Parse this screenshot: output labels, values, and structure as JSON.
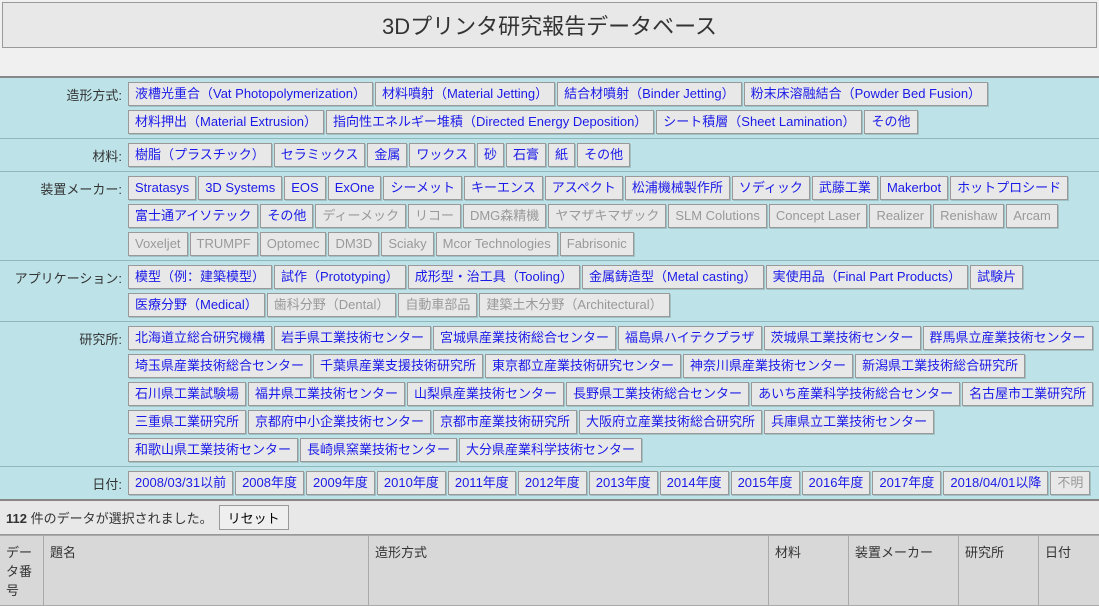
{
  "title": "3Dプリンタ研究報告データベース",
  "filters": [
    {
      "label": "造形方式:",
      "items": [
        {
          "text": "液槽光重合（Vat Photopolymerization）",
          "enabled": true
        },
        {
          "text": "材料噴射（Material Jetting）",
          "enabled": true
        },
        {
          "text": "結合材噴射（Binder Jetting）",
          "enabled": true
        },
        {
          "text": "粉末床溶融結合（Powder Bed Fusion）",
          "enabled": true
        },
        {
          "text": "材料押出（Material Extrusion）",
          "enabled": true
        },
        {
          "text": "指向性エネルギー堆積（Directed Energy Deposition）",
          "enabled": true
        },
        {
          "text": "シート積層（Sheet Lamination）",
          "enabled": true
        },
        {
          "text": "その他",
          "enabled": true
        }
      ]
    },
    {
      "label": "材料:",
      "items": [
        {
          "text": "樹脂（プラスチック）",
          "enabled": true
        },
        {
          "text": "セラミックス",
          "enabled": true
        },
        {
          "text": "金属",
          "enabled": true
        },
        {
          "text": "ワックス",
          "enabled": true
        },
        {
          "text": "砂",
          "enabled": true
        },
        {
          "text": "石膏",
          "enabled": true
        },
        {
          "text": "紙",
          "enabled": true
        },
        {
          "text": "その他",
          "enabled": true
        }
      ]
    },
    {
      "label": "装置メーカー:",
      "items": [
        {
          "text": "Stratasys",
          "enabled": true
        },
        {
          "text": "3D Systems",
          "enabled": true
        },
        {
          "text": "EOS",
          "enabled": true
        },
        {
          "text": "ExOne",
          "enabled": true
        },
        {
          "text": "シーメット",
          "enabled": true
        },
        {
          "text": "キーエンス",
          "enabled": true
        },
        {
          "text": "アスペクト",
          "enabled": true
        },
        {
          "text": "松浦機械製作所",
          "enabled": true
        },
        {
          "text": "ソディック",
          "enabled": true
        },
        {
          "text": "武藤工業",
          "enabled": true
        },
        {
          "text": "Makerbot",
          "enabled": true
        },
        {
          "text": "ホットプロシード",
          "enabled": true
        },
        {
          "text": "富士通アイソテック",
          "enabled": true
        },
        {
          "text": "その他",
          "enabled": true
        },
        {
          "text": "ディーメック",
          "enabled": false
        },
        {
          "text": "リコー",
          "enabled": false
        },
        {
          "text": "DMG森精機",
          "enabled": false
        },
        {
          "text": "ヤマザキマザック",
          "enabled": false
        },
        {
          "text": "SLM Colutions",
          "enabled": false
        },
        {
          "text": "Concept Laser",
          "enabled": false
        },
        {
          "text": "Realizer",
          "enabled": false
        },
        {
          "text": "Renishaw",
          "enabled": false
        },
        {
          "text": "Arcam",
          "enabled": false
        },
        {
          "text": "Voxeljet",
          "enabled": false
        },
        {
          "text": "TRUMPF",
          "enabled": false
        },
        {
          "text": "Optomec",
          "enabled": false
        },
        {
          "text": "DM3D",
          "enabled": false
        },
        {
          "text": "Sciaky",
          "enabled": false
        },
        {
          "text": "Mcor Technologies",
          "enabled": false
        },
        {
          "text": "Fabrisonic",
          "enabled": false
        }
      ]
    },
    {
      "label": "アプリケーション:",
      "items": [
        {
          "text": "模型（例：建築模型）",
          "enabled": true
        },
        {
          "text": "試作（Prototyping）",
          "enabled": true
        },
        {
          "text": "成形型・治工具（Tooling）",
          "enabled": true
        },
        {
          "text": "金属鋳造型（Metal casting）",
          "enabled": true
        },
        {
          "text": "実使用品（Final Part Products）",
          "enabled": true
        },
        {
          "text": "試験片",
          "enabled": true
        },
        {
          "text": "医療分野（Medical）",
          "enabled": true
        },
        {
          "text": "歯科分野（Dental）",
          "enabled": false
        },
        {
          "text": "自動車部品",
          "enabled": false
        },
        {
          "text": "建築土木分野（Architectural）",
          "enabled": false
        }
      ]
    },
    {
      "label": "研究所:",
      "items": [
        {
          "text": "北海道立総合研究機構",
          "enabled": true
        },
        {
          "text": "岩手県工業技術センター",
          "enabled": true
        },
        {
          "text": "宮城県産業技術総合センター",
          "enabled": true
        },
        {
          "text": "福島県ハイテクプラザ",
          "enabled": true
        },
        {
          "text": "茨城県工業技術センター",
          "enabled": true
        },
        {
          "text": "群馬県立産業技術センター",
          "enabled": true
        },
        {
          "text": "埼玉県産業技術総合センター",
          "enabled": true
        },
        {
          "text": "千葉県産業支援技術研究所",
          "enabled": true
        },
        {
          "text": "東京都立産業技術研究センター",
          "enabled": true
        },
        {
          "text": "神奈川県産業技術センター",
          "enabled": true
        },
        {
          "text": "新潟県工業技術総合研究所",
          "enabled": true
        },
        {
          "text": "石川県工業試験場",
          "enabled": true
        },
        {
          "text": "福井県工業技術センター",
          "enabled": true
        },
        {
          "text": "山梨県産業技術センター",
          "enabled": true
        },
        {
          "text": "長野県工業技術総合センター",
          "enabled": true
        },
        {
          "text": "あいち産業科学技術総合センター",
          "enabled": true
        },
        {
          "text": "名古屋市工業研究所",
          "enabled": true
        },
        {
          "text": "三重県工業研究所",
          "enabled": true
        },
        {
          "text": "京都府中小企業技術センター",
          "enabled": true
        },
        {
          "text": "京都市産業技術研究所",
          "enabled": true
        },
        {
          "text": "大阪府立産業技術総合研究所",
          "enabled": true
        },
        {
          "text": "兵庫県立工業技術センター",
          "enabled": true
        },
        {
          "text": "和歌山県工業技術センター",
          "enabled": true
        },
        {
          "text": "長崎県窯業技術センター",
          "enabled": true
        },
        {
          "text": "大分県産業科学技術センター",
          "enabled": true
        }
      ]
    },
    {
      "label": "日付:",
      "items": [
        {
          "text": "2008/03/31以前",
          "enabled": true
        },
        {
          "text": "2008年度",
          "enabled": true
        },
        {
          "text": "2009年度",
          "enabled": true
        },
        {
          "text": "2010年度",
          "enabled": true
        },
        {
          "text": "2011年度",
          "enabled": true
        },
        {
          "text": "2012年度",
          "enabled": true
        },
        {
          "text": "2013年度",
          "enabled": true
        },
        {
          "text": "2014年度",
          "enabled": true
        },
        {
          "text": "2015年度",
          "enabled": true
        },
        {
          "text": "2016年度",
          "enabled": true
        },
        {
          "text": "2017年度",
          "enabled": true
        },
        {
          "text": "2018/04/01以降",
          "enabled": true
        },
        {
          "text": "不明",
          "enabled": false
        }
      ]
    }
  ],
  "result": {
    "count": "112",
    "suffix": " 件のデータが選択されました。",
    "reset": "リセット"
  },
  "columns": {
    "no": "データ番号",
    "title": "題名",
    "method": "造形方式",
    "material": "材料",
    "maker": "装置メーカー",
    "lab": "研究所",
    "date": "日付"
  }
}
